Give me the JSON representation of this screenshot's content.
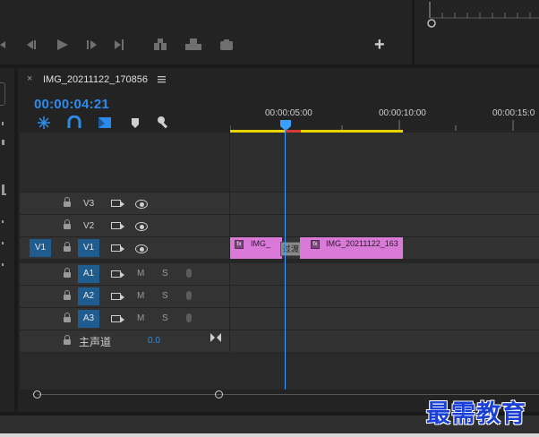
{
  "sequence": {
    "tab_title": "IMG_20211122_170856",
    "timecode": "00:00:04:21",
    "menu_icon": "hamburger-icon"
  },
  "ruler": {
    "labels": [
      "00:00:05:00",
      "00:00:10:00",
      "00:00:15:0"
    ]
  },
  "tracks": {
    "video": [
      {
        "name": "V3"
      },
      {
        "name": "V2"
      },
      {
        "name": "V1",
        "source": "V1"
      }
    ],
    "audio": [
      {
        "name": "A1",
        "m": "M",
        "s": "S"
      },
      {
        "name": "A2",
        "m": "M",
        "s": "S"
      },
      {
        "name": "A3",
        "m": "M",
        "s": "S"
      }
    ],
    "master": {
      "label": "主声道",
      "value": "0.0"
    }
  },
  "clips": {
    "clip1": "IMG_",
    "clip2": "IMG_20211122_163",
    "transition": "过渡"
  },
  "watermark": "最需教育",
  "colors": {
    "accent_blue": "#2d8ceb",
    "clip_pink": "#d97ad9",
    "track_blue": "#1f5c8f",
    "work_area_yellow": "#e8d400",
    "playhead_blue": "#3aa0ff"
  }
}
